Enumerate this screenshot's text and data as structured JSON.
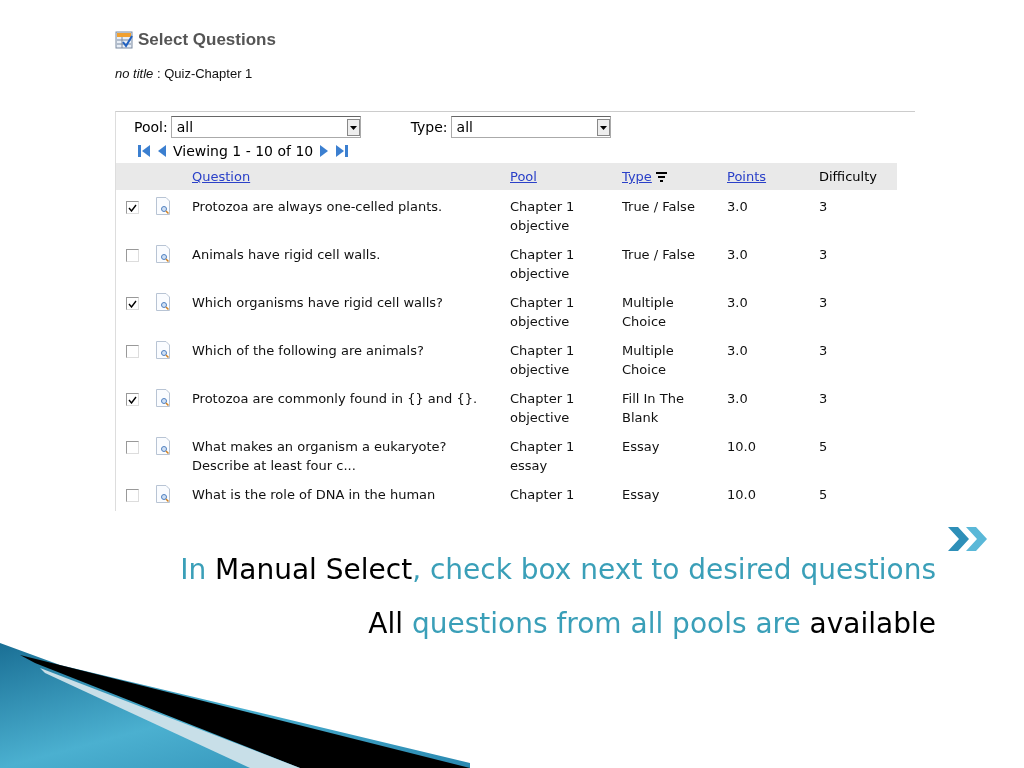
{
  "screenshot": {
    "title": "Select Questions",
    "subtitle": "*no title* : Quiz-Chapter 1",
    "filters": [
      {
        "label": "Pool:",
        "value": "all"
      },
      {
        "label": "Type:",
        "value": "all"
      }
    ],
    "pager": "Viewing 1 - 10 of 10",
    "columns": [
      {
        "label": "Question",
        "kind": "link",
        "sorted": false
      },
      {
        "label": "Pool",
        "kind": "link",
        "sorted": false
      },
      {
        "label": "Type",
        "kind": "link",
        "sorted": true
      },
      {
        "label": "Points",
        "kind": "link",
        "sorted": false
      },
      {
        "label": "Difficulty",
        "kind": "plain",
        "sorted": false
      }
    ],
    "rows": [
      {
        "checked": true,
        "question": "Protozoa are always one-celled plants.",
        "pool": "Chapter 1 objective",
        "type": "True / False",
        "points": "3.0",
        "difficulty": "3"
      },
      {
        "checked": false,
        "question": "Animals have rigid cell walls.",
        "pool": "Chapter 1 objective",
        "type": "True / False",
        "points": "3.0",
        "difficulty": "3"
      },
      {
        "checked": true,
        "question": "Which organisms have rigid cell walls?",
        "pool": "Chapter 1 objective",
        "type": "Multiple Choice",
        "points": "3.0",
        "difficulty": "3"
      },
      {
        "checked": false,
        "question": "Which of the following are animals?",
        "pool": "Chapter 1 objective",
        "type": "Multiple Choice",
        "points": "3.0",
        "difficulty": "3"
      },
      {
        "checked": true,
        "question": "Protozoa are commonly found in {} and {}.",
        "pool": "Chapter 1 objective",
        "type": "Fill In The Blank",
        "points": "3.0",
        "difficulty": "3"
      },
      {
        "checked": false,
        "question": "What makes an organism a eukaryote? Describe at least four c...",
        "pool": "Chapter 1 essay",
        "type": "Essay",
        "points": "10.0",
        "difficulty": "5"
      },
      {
        "checked": false,
        "question": "What is the role of DNA in the human",
        "pool": "Chapter 1",
        "type": "Essay",
        "points": "10.0",
        "difficulty": "5"
      }
    ]
  },
  "caption": [
    "In **Manual Select**, check box next to desired questions",
    "**All** questions from all pools are **available**"
  ]
}
